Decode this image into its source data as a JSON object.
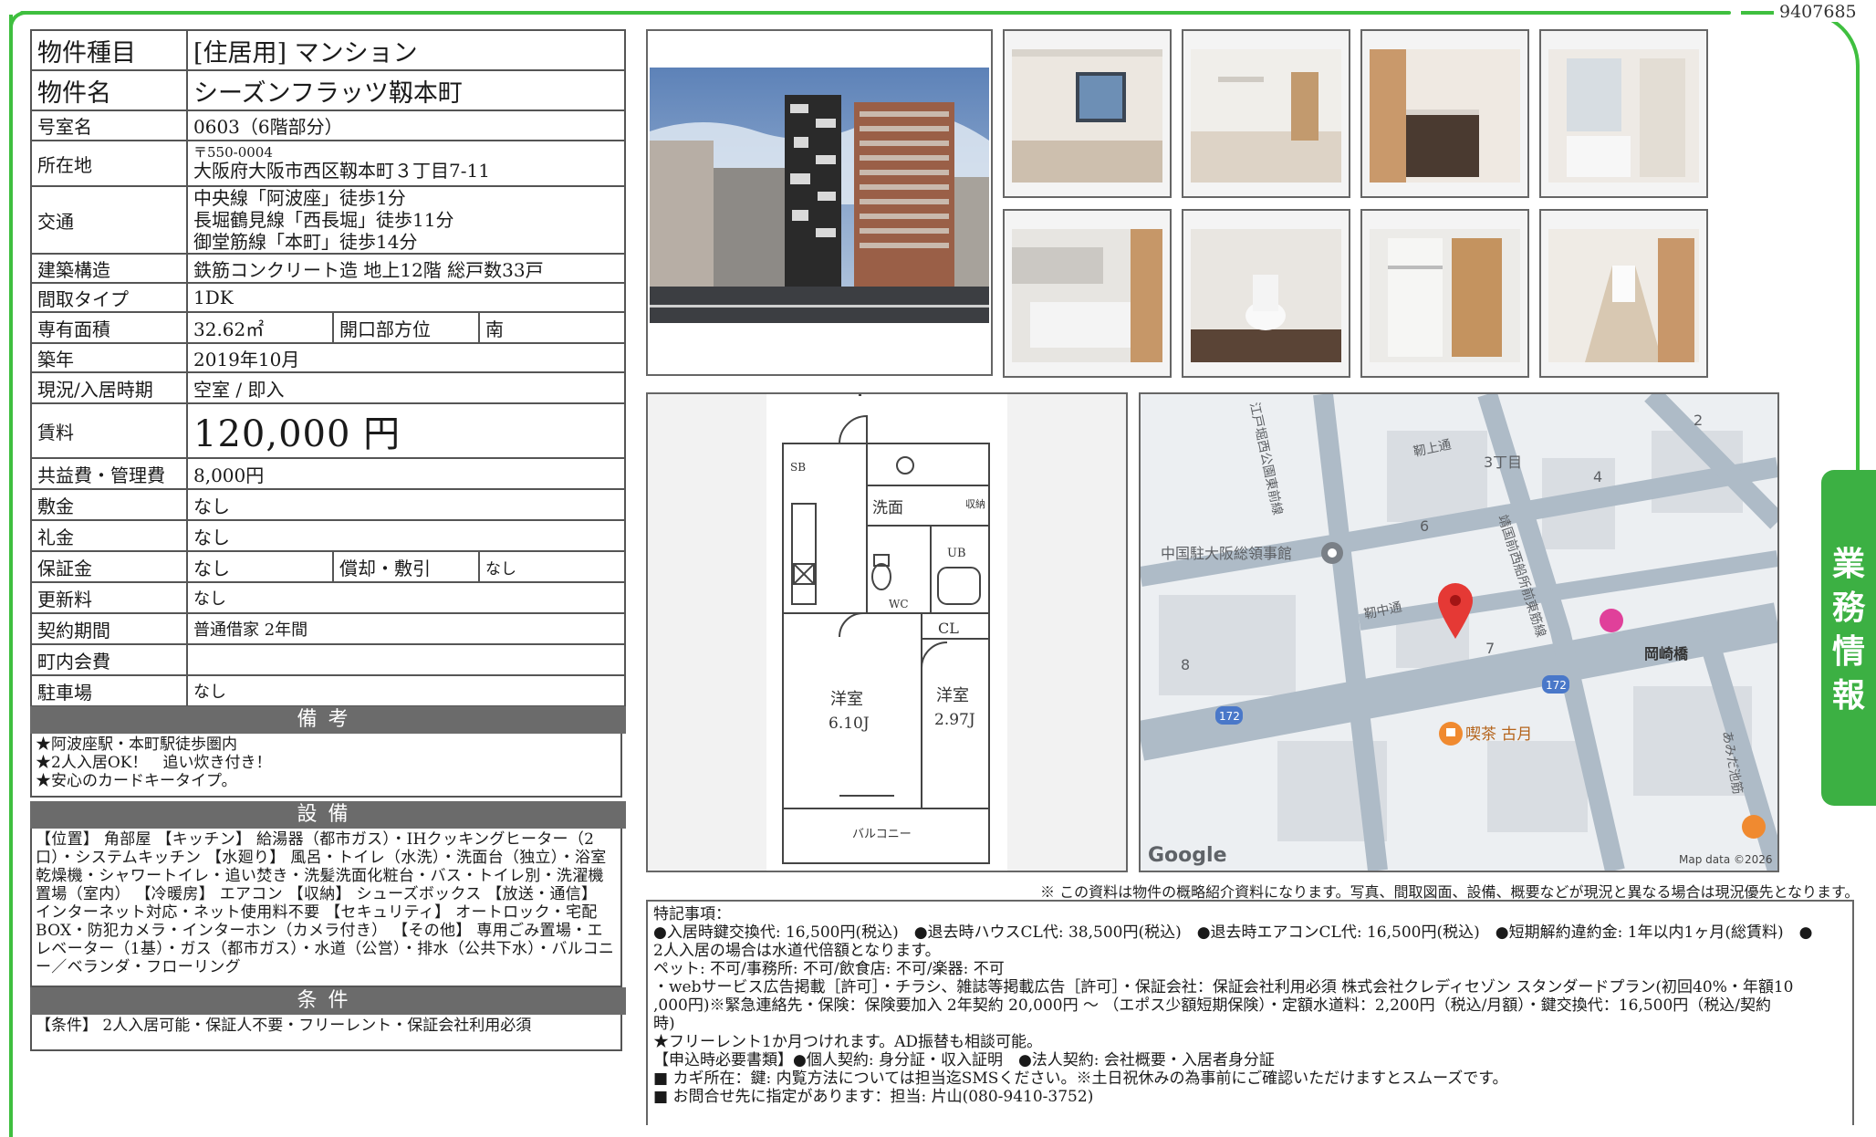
{
  "doc_id": "9407685",
  "table": {
    "type_label": "物件種目",
    "type_value": "[住居用] マンション",
    "name_label": "物件名",
    "name_value": "シーズンフラッツ靱本町",
    "room_label": "号室名",
    "room_value": "0603（6階部分）",
    "addr_label": "所在地",
    "addr_zip": "〒550-0004",
    "addr_value": "大阪府大阪市西区靱本町３丁目7-11",
    "access_label": "交通",
    "access": [
      "中央線「阿波座」徒歩1分",
      "長堀鶴見線「西長堀」徒歩11分",
      "御堂筋線「本町」徒歩14分"
    ],
    "structure_label": "建築構造",
    "structure_value": "鉄筋コンクリート造 地上12階 総戸数33戸",
    "layout_label": "間取タイプ",
    "layout_value": "1DK",
    "area_label": "専有面積",
    "area_value": "32.62㎡",
    "direction_label": "開口部方位",
    "direction_value": "南",
    "built_label": "築年",
    "built_value": "2019年10月",
    "status_label": "現況/入居時期",
    "status_value": "空室 / 即入",
    "rent_label": "賃料",
    "rent_value": "120,000 円",
    "fee_label": "共益費・管理費",
    "fee_value": "8,000円",
    "deposit_label": "敷金",
    "deposit_value": "なし",
    "key_label": "礼金",
    "key_value": "なし",
    "guarantee_label": "保証金",
    "guarantee_value": "なし",
    "amort_label": "償却・敷引",
    "amort_value": "なし",
    "renew_label": "更新料",
    "renew_value": "なし",
    "contract_label": "契約期間",
    "contract_value": "普通借家 2年間",
    "town_label": "町内会費",
    "town_value": "",
    "parking_label": "駐車場",
    "parking_value": "なし"
  },
  "remarks": {
    "heading": "備考",
    "lines": [
      "★阿波座駅・本町駅徒歩圏内",
      "★2人入居OK！　追い炊き付き！",
      "★安心のカードキータイプ。"
    ]
  },
  "equipment": {
    "heading": "設備",
    "text": "【位置】 角部屋 【キッチン】 給湯器（都市ガス）・IHクッキングヒーター（2口）・システムキッチン 【水廻り】 風呂・トイレ（水洗）・洗面台（独立）・浴室乾燥機・シャワートイレ・追い焚き・洗髪洗面化粧台・バス・トイレ別・洗濯機置場（室内） 【冷暖房】 エアコン 【収納】 シューズボックス 【放送・通信】 インターネット対応・ネット使用料不要 【セキュリティ】 オートロック・宅配BOX・防犯カメラ・インターホン（カメラ付き） 【その他】 専用ごみ置場・エレベーター（1基）・ガス（都市ガス）・水道（公営）・排水（公共下水）・バルコニー／ベランダ・フローリング"
  },
  "conditions": {
    "heading": "条件",
    "text": "【条件】 2人入居可能・保証人不要・フリーレント・保証会社利用必須"
  },
  "floorplan": {
    "sb": "SB",
    "wash": "洗面",
    "storage": "収納",
    "ub": "UB",
    "wc": "WC",
    "cl": "CL",
    "room1": "洋室",
    "room1_size": "6.10J",
    "room2": "洋室",
    "room2_size": "2.97J",
    "balcony": "バルコニー"
  },
  "map": {
    "labels": {
      "consulate": "中国駐大阪総領事館",
      "chome": "3丁目",
      "okazaki": "岡崎橋",
      "cafe": "喫茶 古月",
      "road_a": "江戸堀西公園東前線",
      "road_b": "靭上通",
      "road_c": "靭中通",
      "road_d": "靖国前西船所前東筋線",
      "road_e": "あみだ池筋",
      "n2": "2",
      "n4": "4",
      "n6": "6",
      "n7": "7",
      "n8": "8",
      "route1": "172",
      "route2": "172",
      "brand": "Google",
      "credit": "Map data ©2026"
    }
  },
  "notice": "※ この資料は物件の概略紹介資料になります。写真、間取図面、設備、概要などが現況と異なる場合は現況優先となります。",
  "notes": {
    "lines": [
      "特記事項：",
      "●入居時鍵交換代: 16,500円(税込)　●退去時ハウスCL代: 38,500円(税込)　●退去時エアコンCL代: 16,500円(税込)　●短期解約違約金: 1年以内1ヶ月(総賃料)　●",
      "2人入居の場合は水道代倍額となります。",
      "ペット: 不可/事務所: 不可/飲食店: 不可/楽器: 不可",
      "・webサービス広告掲載［許可］・チラシ、雑誌等掲載広告［許可］・保証会社：保証会社利用必須 株式会社クレディセゾン スタンダードプラン(初回40%・年額10",
      ",000円)※緊急連絡先・保険：保険要加入 2年契約 20,000円 〜 （エポス少額短期保険）・定額水道料：2,200円（税込/月額）・鍵交換代：16,500円（税込/契約",
      "時)",
      "★フリーレント1か月つけれます。AD振替も相談可能。",
      "【申込時必要書類】●個人契約: 身分証・収入証明　●法人契約: 会社概要・入居者身分証",
      "■ カギ所在：鍵: 内覧方法については担当迄SMSください。※土日祝休みの為事前にご確認いただけますとスムーズです。",
      "■ お問合せ先に指定があります：担当: 片山(080-9410-3752)"
    ]
  },
  "side_tab": [
    "業",
    "務",
    "情",
    "報"
  ]
}
